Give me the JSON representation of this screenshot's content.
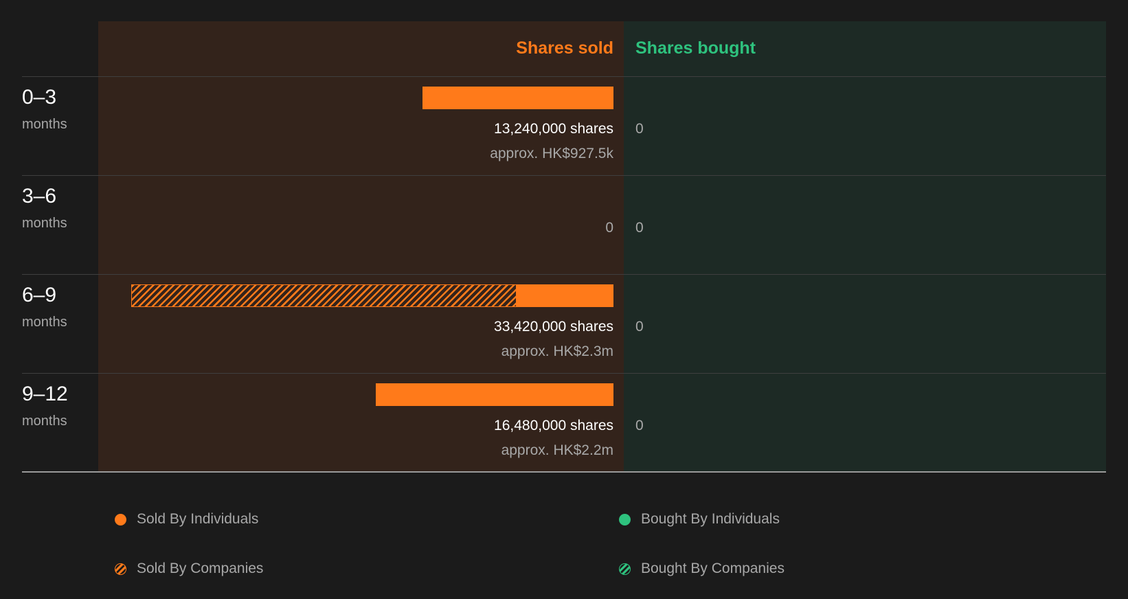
{
  "chart_data": {
    "type": "bar",
    "columns": {
      "sold": "Shares sold",
      "bought": "Shares bought"
    },
    "categories": [
      {
        "period": "0–3",
        "unit": "months"
      },
      {
        "period": "3–6",
        "unit": "months"
      },
      {
        "period": "6–9",
        "unit": "months"
      },
      {
        "period": "9–12",
        "unit": "months"
      }
    ],
    "rows": [
      {
        "sold_individuals": 13240000,
        "sold_companies": 0,
        "sold_label": "13,240,000 shares",
        "sold_value_label": "approx. HK$927.5k",
        "bought_label": "0"
      },
      {
        "sold_individuals": 0,
        "sold_companies": 0,
        "sold_label": "0",
        "sold_value_label": "",
        "bought_label": "0"
      },
      {
        "sold_individuals": 6700000,
        "sold_companies": 26720000,
        "sold_label": "33,420,000 shares",
        "sold_value_label": "approx. HK$2.3m",
        "bought_label": "0"
      },
      {
        "sold_individuals": 16480000,
        "sold_companies": 0,
        "sold_label": "16,480,000 shares",
        "sold_value_label": "approx. HK$2.2m",
        "bought_label": "0"
      }
    ],
    "xlim": [
      0,
      35000000
    ],
    "legend": [
      {
        "label": "Sold By Individuals",
        "color": "#ff7a1a",
        "style": "solid"
      },
      {
        "label": "Bought By Individuals",
        "color": "#2ec27e",
        "style": "solid"
      },
      {
        "label": "Sold By Companies",
        "color": "#ff7a1a",
        "style": "hatched"
      },
      {
        "label": "Bought By Companies",
        "color": "#2ec27e",
        "style": "hatched"
      }
    ],
    "colors": {
      "sold": "#ff7a1a",
      "bought": "#2ec27e"
    }
  }
}
